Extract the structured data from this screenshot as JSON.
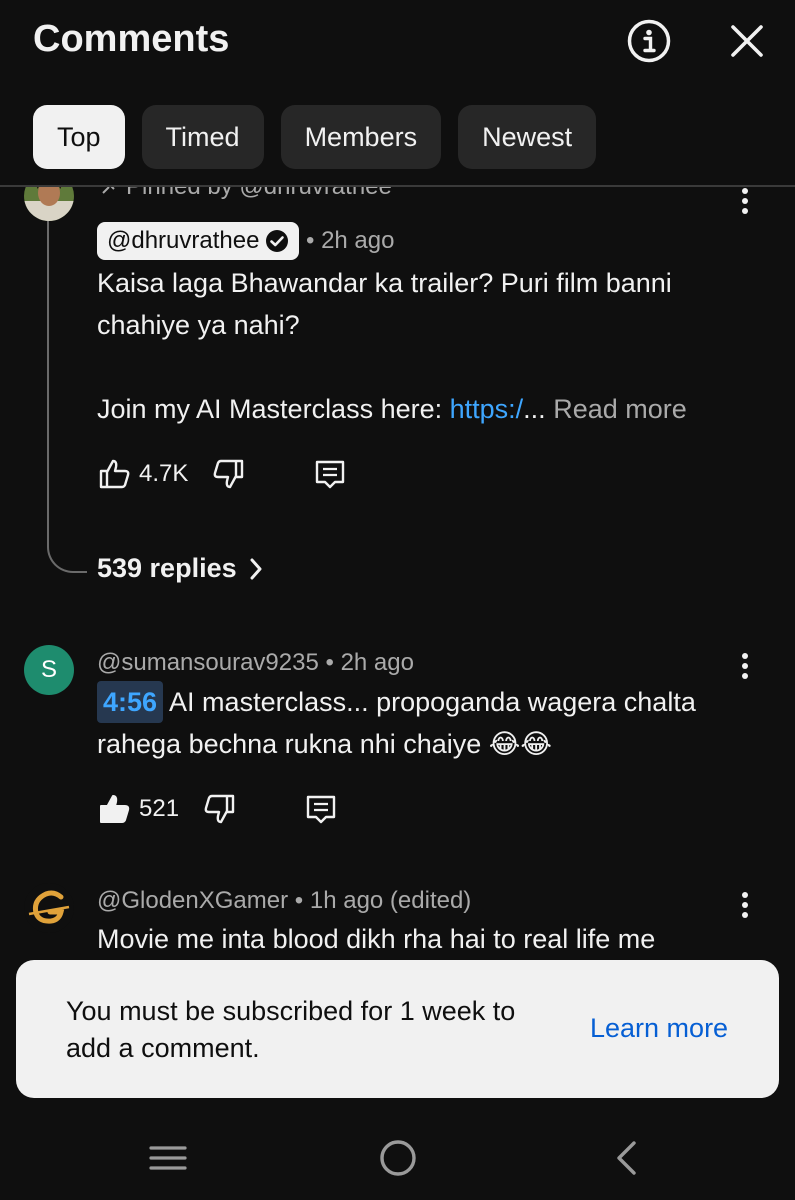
{
  "header": {
    "title": "Comments",
    "info_icon": "info-icon",
    "close_icon": "close-icon"
  },
  "chips": [
    {
      "label": "Top",
      "active": true
    },
    {
      "label": "Timed",
      "active": false
    },
    {
      "label": "Members",
      "active": false
    },
    {
      "label": "Newest",
      "active": false
    }
  ],
  "comments": [
    {
      "pinned_label": "Pinned by @dhruvrathee",
      "author": "@dhruvrathee",
      "verified": true,
      "time": "• 2h ago",
      "line1": "Kaisa laga Bhawandar ka trailer? Puri film banni",
      "line2": "chahiye ya nahi?",
      "line3_prefix": "Join my AI Masterclass here: ",
      "line3_link": "https:/",
      "line3_ellipsis": "...",
      "read_more": "Read more",
      "likes": "4.7K",
      "replies": "539 replies"
    },
    {
      "avatar_letter": "S",
      "avatar_color": "#1e8c6e",
      "author": "@sumansourav9235",
      "time": "• 2h ago",
      "timestamp": "4:56",
      "line1_rest": "AI masterclass... propoganda wagera chalta",
      "line2": "rahega bechna rukna nhi chaiye 😂😂",
      "likes": "521"
    },
    {
      "author": "@GlodenXGamer",
      "time": "• 1h ago (edited)",
      "line1": "Movie me inta blood dikh rha hai to real life me"
    }
  ],
  "toast": {
    "message": "You must be subscribed for 1 week to add a comment.",
    "link": "Learn more"
  },
  "colors": {
    "background": "#0f0f0f",
    "chip": "#272727",
    "accent_link": "#3ea6ff",
    "toast_link": "#065fd4"
  }
}
